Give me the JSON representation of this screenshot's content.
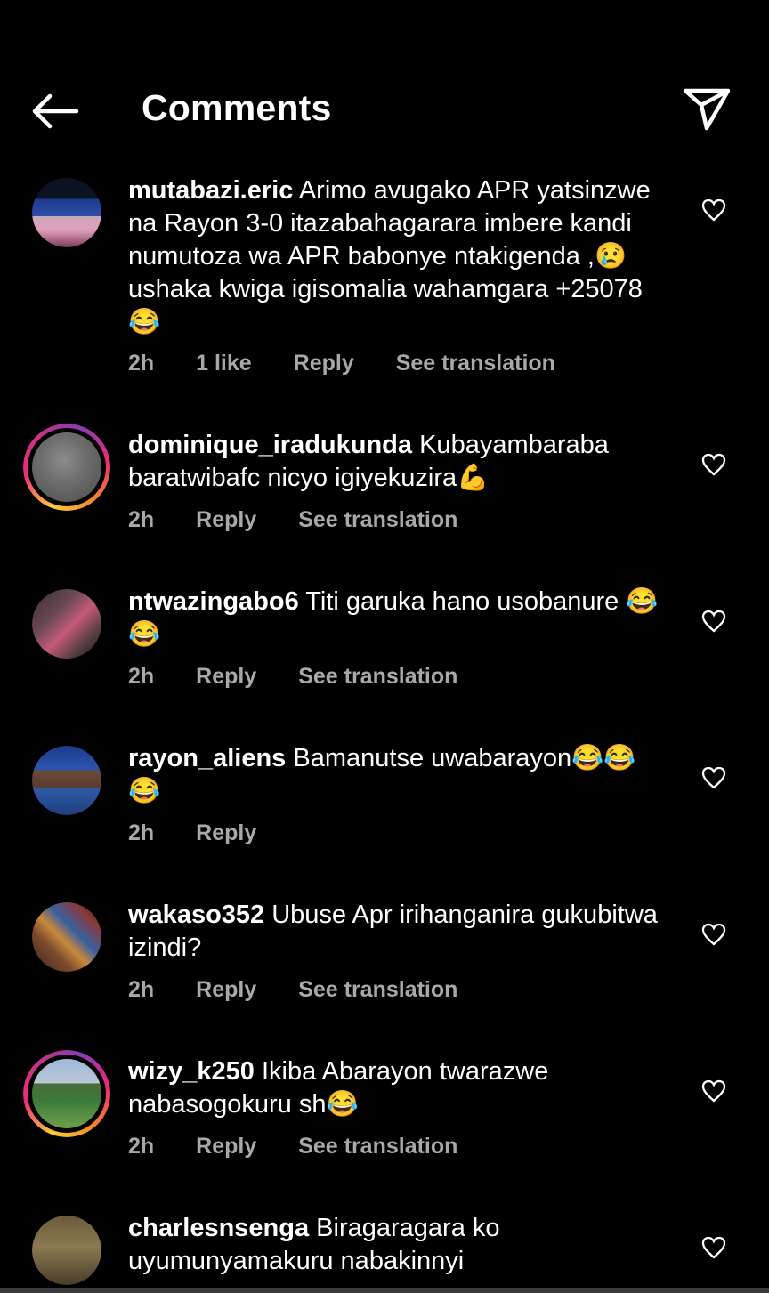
{
  "header": {
    "title": "Comments",
    "back_icon": "arrow-left-icon",
    "share_icon": "paper-plane-icon"
  },
  "comments": [
    {
      "username": "mutabazi.eric",
      "text": "Arimo avugako APR yatsinzwe na Rayon 3-0 itazabahagarara imbere kandi numutoza wa APR babonye ntakigenda ,😢ushaka kwiga igisomalia wahamgara +25078😂",
      "time": "2h",
      "likes": "1 like",
      "reply": "Reply",
      "translate": "See translation"
    },
    {
      "username": "dominique_iradukunda",
      "text": "Kubayambaraba baratwibafc nicyo igiyekuzira💪",
      "time": "2h",
      "reply": "Reply",
      "translate": "See translation"
    },
    {
      "username": "ntwazingabo6",
      "text": "Titi garuka hano usobanure 😂😂",
      "time": "2h",
      "reply": "Reply",
      "translate": "See translation"
    },
    {
      "username": "rayon_aliens",
      "text": "Bamanutse uwabarayon😂😂😂",
      "time": "2h",
      "reply": "Reply"
    },
    {
      "username": "wakaso352",
      "text": "Ubuse Apr irihanganira gukubitwa izindi?",
      "time": "2h",
      "reply": "Reply",
      "translate": "See translation"
    },
    {
      "username": "wizy_k250",
      "text": "Ikiba Abarayon twarazwe nabasogokuru sh😂",
      "time": "2h",
      "reply": "Reply",
      "translate": "See translation"
    },
    {
      "username": "charlesnsenga",
      "text": "Biragaragara ko uyumunyamakuru nabakinnyi"
    }
  ]
}
